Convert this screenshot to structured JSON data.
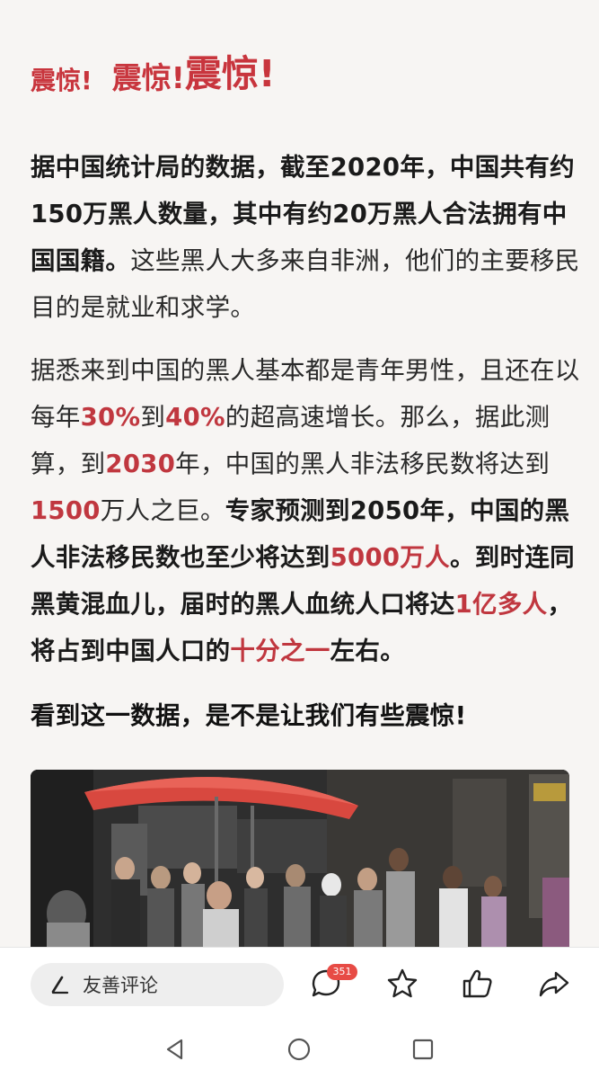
{
  "headline": {
    "w1": "震惊!",
    "w2": "震惊!",
    "w3": "震惊!"
  },
  "para1": {
    "bold": "据中国统计局的数据，截至2020年，中国共有约150万黑人数量，其中有约20万黑人合法拥有中国国籍。",
    "normal": "这些黑人大多来自非洲，他们的主要移民目的是就业和求学。"
  },
  "para2": {
    "t1": "据悉来到中国的黑人基本都是青年男性，且还在以每年",
    "r1": "30%",
    "t2": "到",
    "r2": "40%",
    "t3": "的超高速增长。那么，据此测算，到",
    "r3": "2030",
    "t4": "年，中国的黑人非法移民数将达到",
    "r4": "1500",
    "t5": "万人之巨。",
    "b1": "专家预测到2050年，中国的黑人非法移民数也至少将达到",
    "r5": "5000万人",
    "b2": "。到时连同黑黄混血儿，届时的黑人血统人口将达",
    "r6": "1亿多人",
    "b3": "，将占到中国人口的",
    "r7": "十分之一",
    "b4": "左右。"
  },
  "para3": "看到这一数据，是不是让我们有些震惊!",
  "bottom_bar": {
    "comment_placeholder": "友善评论",
    "comment_count": "351"
  },
  "colors": {
    "accent_red": "#c0373f",
    "badge": "#e74b45"
  }
}
